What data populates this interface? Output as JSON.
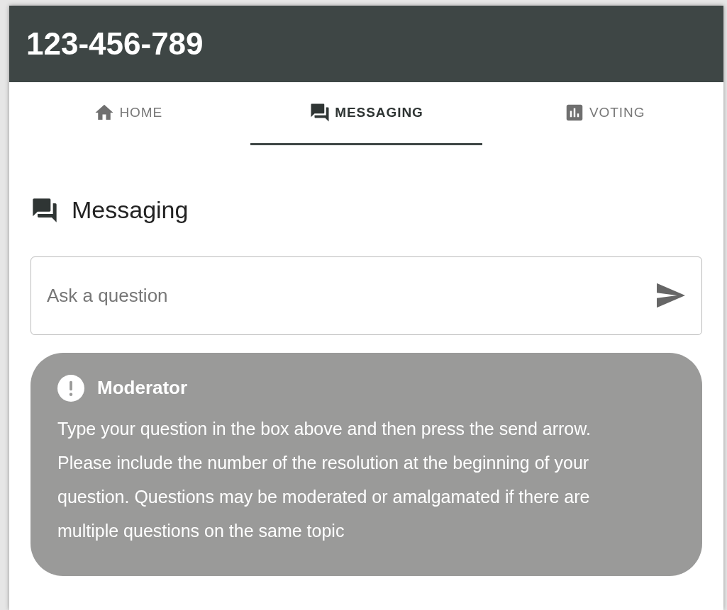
{
  "header": {
    "title": "123-456-789"
  },
  "tabs": [
    {
      "label": "HOME",
      "selected": false
    },
    {
      "label": "MESSAGING",
      "selected": true
    },
    {
      "label": "VOTING",
      "selected": false
    }
  ],
  "section": {
    "title": "Messaging"
  },
  "question_field": {
    "placeholder": "Ask a question"
  },
  "moderator_message": {
    "author": "Moderator",
    "text": "Type your question in the box above and then press the send arrow. Please include the number of the resolution at the beginning of your question. Questions may be moderated or amalgamated if there are multiple questions on the same topic"
  }
}
